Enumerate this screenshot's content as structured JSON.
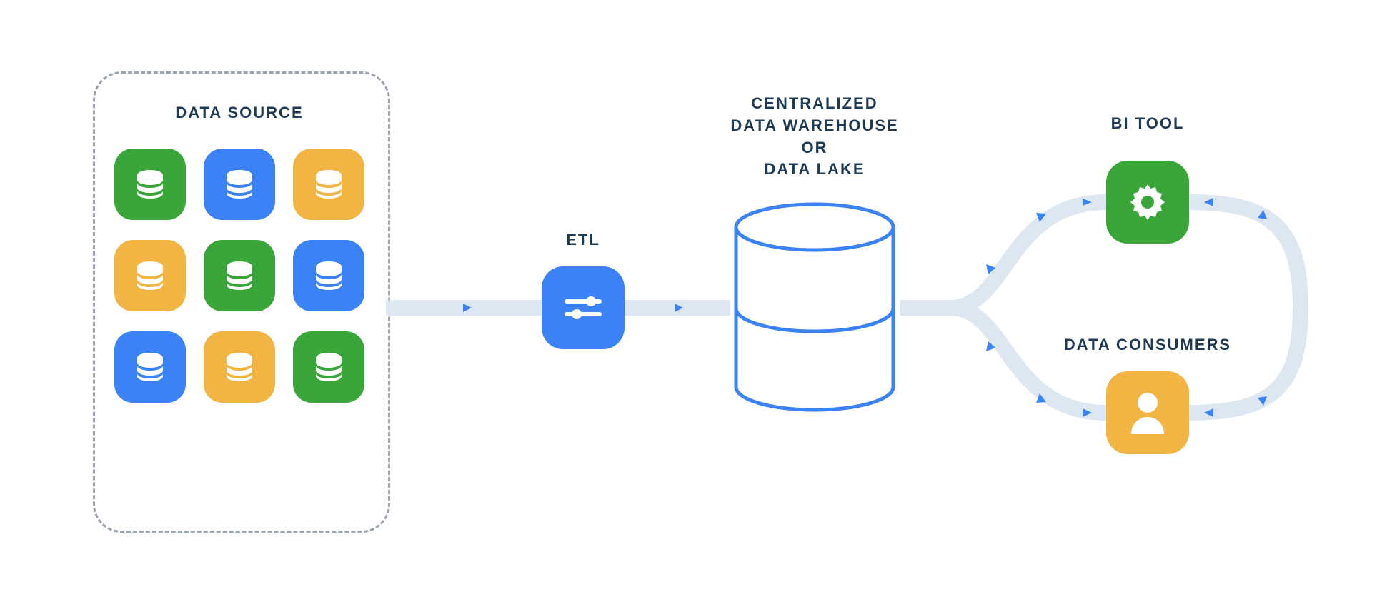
{
  "labels": {
    "data_source": "DATA SOURCE",
    "etl": "ETL",
    "warehouse_l1": "CENTRALIZED",
    "warehouse_l2": "DATA WAREHOUSE",
    "warehouse_l3": "OR",
    "warehouse_l4": "DATA LAKE",
    "bi_tool": "BI TOOL",
    "data_consumers": "DATA CONSUMERS"
  },
  "data_source_tiles": [
    {
      "color": "green"
    },
    {
      "color": "blue"
    },
    {
      "color": "orange"
    },
    {
      "color": "orange"
    },
    {
      "color": "green"
    },
    {
      "color": "blue"
    },
    {
      "color": "blue"
    },
    {
      "color": "orange"
    },
    {
      "color": "green"
    }
  ],
  "nodes": {
    "etl": {
      "icon": "sliders",
      "color": "blue"
    },
    "bi": {
      "icon": "gear",
      "color": "green"
    },
    "consumers": {
      "icon": "user",
      "color": "orange"
    }
  }
}
